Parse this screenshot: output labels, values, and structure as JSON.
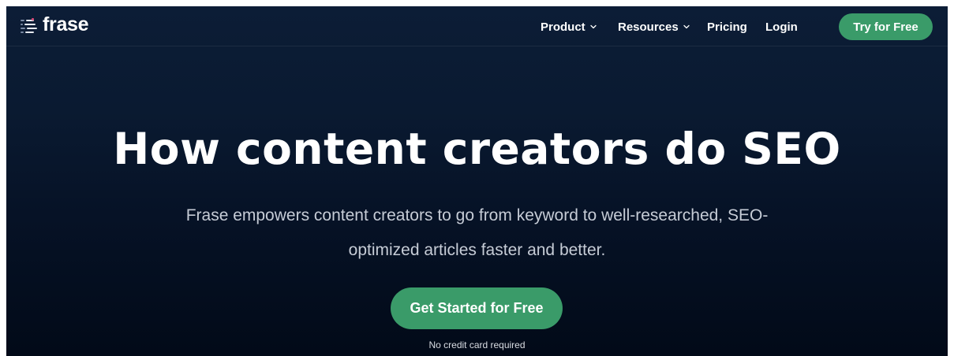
{
  "brand": {
    "name": "frase"
  },
  "nav": {
    "items": [
      {
        "label": "Product",
        "has_dropdown": true
      },
      {
        "label": "Resources",
        "has_dropdown": true
      },
      {
        "label": "Pricing",
        "has_dropdown": false
      },
      {
        "label": "Login",
        "has_dropdown": false
      }
    ],
    "cta_label": "Try for Free"
  },
  "hero": {
    "title": "How content creators do SEO",
    "subtitle_line1": "Frase empowers content creators to go from keyword to well-researched, SEO-",
    "subtitle_line2": "optimized articles faster and better.",
    "cta_label": "Get Started for Free",
    "note": "No credit card required"
  },
  "colors": {
    "background_top": "#0c1d36",
    "background_bottom": "#020a18",
    "accent_green": "#3a9b69",
    "text_white": "#ffffff",
    "text_muted": "#c6ccd6"
  },
  "icons": {
    "logo": "frase-logo-icon",
    "dropdown": "chevron-down-icon"
  }
}
